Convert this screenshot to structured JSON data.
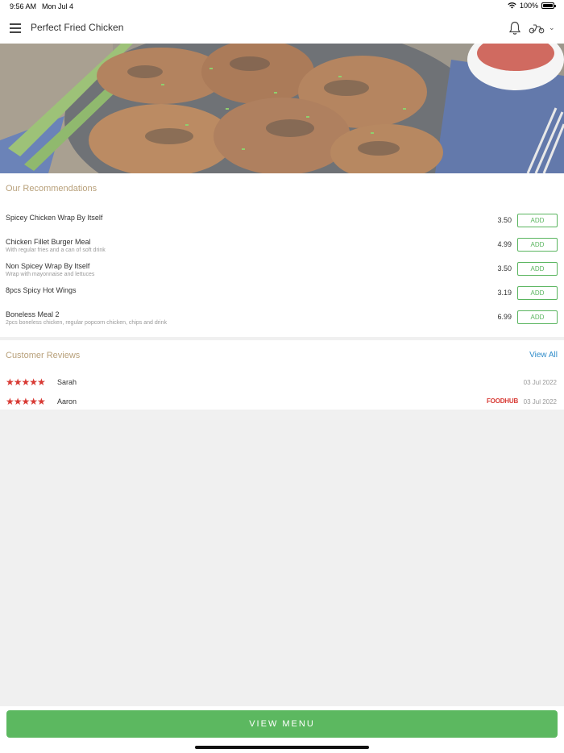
{
  "status_bar": {
    "time": "9:56 AM",
    "date": "Mon Jul 4",
    "battery": "100%"
  },
  "header": {
    "title": "Perfect Fried Chicken",
    "bell_icon": "bell-icon",
    "delivery_icon": "scooter-icon"
  },
  "recommendations": {
    "title": "Our Recommendations",
    "add_label": "ADD",
    "items": [
      {
        "name": "Spicey Chicken Wrap By Itself",
        "description": "",
        "price": "3.50"
      },
      {
        "name": "Chicken Fillet Burger Meal",
        "description": "With regular fries and a can of soft drink",
        "price": "4.99"
      },
      {
        "name": "Non Spicey Wrap By Itself",
        "description": "Wrap with mayonnaise and lettuces",
        "price": "3.50"
      },
      {
        "name": "8pcs Spicy Hot Wings",
        "description": "",
        "price": "3.19"
      },
      {
        "name": "Boneless Meal 2",
        "description": "2pcs boneless chicken, regular popcorn chicken, chips and drink",
        "price": "6.99"
      }
    ]
  },
  "reviews": {
    "title": "Customer Reviews",
    "view_all": "View All",
    "items": [
      {
        "name": "Sarah",
        "rating": 5,
        "date": "03 Jul 2022",
        "source": ""
      },
      {
        "name": "Aaron",
        "rating": 5,
        "date": "03 Jul 2022",
        "source": "FOODHUB"
      }
    ]
  },
  "footer": {
    "view_menu": "VIEW MENU"
  },
  "colors": {
    "accent_green": "#5cb860",
    "section_title": "#b8a07a",
    "star_red": "#d83a34",
    "link_blue": "#2e8bc9"
  }
}
